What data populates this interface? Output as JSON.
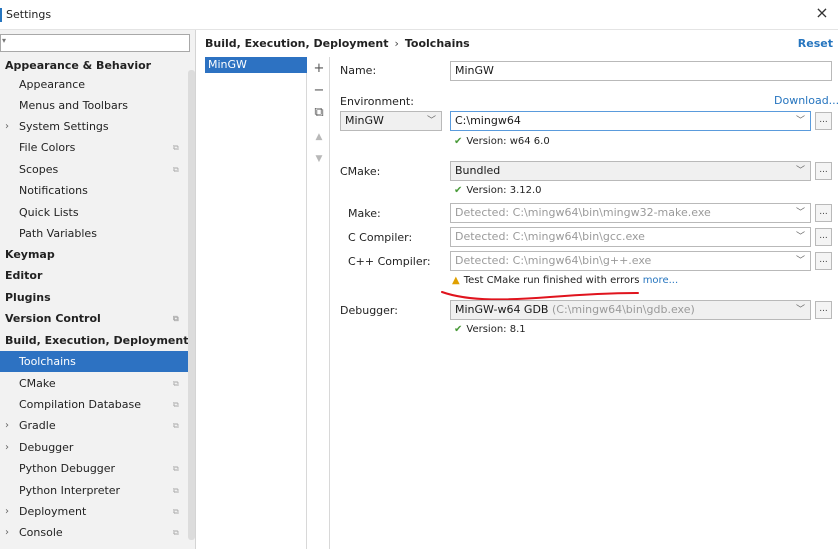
{
  "window": {
    "title": "Settings",
    "close_glyph": "×"
  },
  "search": {
    "placeholder": "",
    "icon": "search-icon"
  },
  "sidebar": {
    "items": [
      {
        "label": "Appearance & Behavior",
        "bold": true,
        "arrow": false
      },
      {
        "label": "Appearance",
        "bold": false
      },
      {
        "label": "Menus and Toolbars",
        "bold": false
      },
      {
        "label": "System Settings",
        "bold": false,
        "arrow": true
      },
      {
        "label": "File Colors",
        "bold": false
      },
      {
        "label": "Scopes",
        "bold": false
      },
      {
        "label": "Notifications",
        "bold": false
      },
      {
        "label": "Quick Lists",
        "bold": false
      },
      {
        "label": "Path Variables",
        "bold": false
      },
      {
        "label": "Keymap",
        "bold": true
      },
      {
        "label": "Editor",
        "bold": true
      },
      {
        "label": "Plugins",
        "bold": true
      },
      {
        "label": "Version Control",
        "bold": true
      },
      {
        "label": "Build, Execution, Deployment",
        "bold": true
      },
      {
        "label": "Toolchains",
        "bold": false,
        "selected": true
      },
      {
        "label": "CMake",
        "bold": false
      },
      {
        "label": "Compilation Database",
        "bold": false
      },
      {
        "label": "Gradle",
        "bold": false,
        "arrow": true
      },
      {
        "label": "Debugger",
        "bold": false,
        "arrow": true
      },
      {
        "label": "Python Debugger",
        "bold": false
      },
      {
        "label": "Python Interpreter",
        "bold": false
      },
      {
        "label": "Deployment",
        "bold": false,
        "arrow": true
      },
      {
        "label": "Console",
        "bold": false,
        "arrow": true
      }
    ]
  },
  "header": {
    "breadcrumb_parent": "Build, Execution, Deployment",
    "breadcrumb_sep": "›",
    "breadcrumb_current": "Toolchains",
    "reset": "Reset"
  },
  "toolchains": {
    "list": [
      "MinGW"
    ],
    "toolbar": {
      "add": "+",
      "remove": "−",
      "copy": "⧉",
      "up": "▲",
      "down": "▼"
    }
  },
  "form": {
    "name_label": "Name:",
    "name_value": "MinGW",
    "environment_label": "Environment:",
    "download_link": "Download...",
    "env_type": "MinGW",
    "env_path": "C:\\mingw64",
    "env_version": "Version: w64 6.0",
    "cmake_label": "CMake:",
    "cmake_value": "Bundled",
    "cmake_version": "Version: 3.12.0",
    "make_label": "Make:",
    "make_value": "Detected: C:\\mingw64\\bin\\mingw32-make.exe",
    "c_label": "C Compiler:",
    "c_value": "Detected: C:\\mingw64\\bin\\gcc.exe",
    "cpp_label": "C++ Compiler:",
    "cpp_value": "Detected: C:\\mingw64\\bin\\g++.exe",
    "warning_text": "Test CMake run finished with errors",
    "warning_link": "more...",
    "debugger_label": "Debugger:",
    "debugger_value": "MinGW-w64 GDB",
    "debugger_path": "(C:\\mingw64\\bin\\gdb.exe)",
    "debugger_version": "Version: 8.1",
    "browse": "..."
  },
  "colors": {
    "selection": "#2d72c2",
    "link": "#2675bf",
    "ok": "#4a9b3a",
    "warning": "#e0a000",
    "annotation": "#e0141e"
  }
}
